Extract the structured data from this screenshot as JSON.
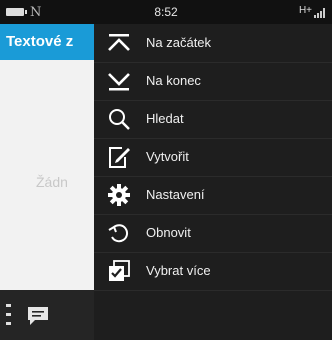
{
  "status_bar": {
    "time": "8:52",
    "network": "H+",
    "notification": "N"
  },
  "app": {
    "title": "Textové z",
    "empty_text": "Žádn"
  },
  "menu": {
    "items": [
      {
        "label": "Na začátek",
        "icon": "scroll-to-top-icon"
      },
      {
        "label": "Na konec",
        "icon": "scroll-to-bottom-icon"
      },
      {
        "label": "Hledat",
        "icon": "search-icon"
      },
      {
        "label": "Vytvořit",
        "icon": "compose-icon"
      },
      {
        "label": "Nastavení",
        "icon": "gear-icon"
      },
      {
        "label": "Obnovit",
        "icon": "refresh-icon"
      },
      {
        "label": "Vybrat více",
        "icon": "select-multiple-icon"
      }
    ]
  },
  "colors": {
    "title_bar": "#1a9bd7",
    "menu_background": "#1e1e1e",
    "status_bar": "#111111"
  }
}
